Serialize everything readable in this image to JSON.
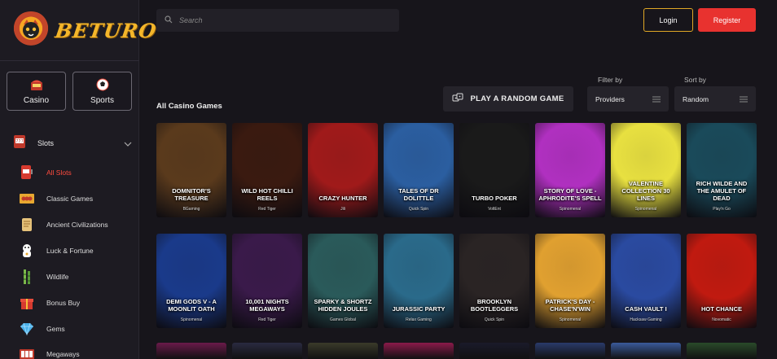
{
  "brand": {
    "name": "BETURO"
  },
  "sidebar": {
    "categories": [
      {
        "label": "Casino",
        "icon": "casino-icon"
      },
      {
        "label": "Sports",
        "icon": "soccer-ball-icon"
      }
    ],
    "section": {
      "label": "Slots",
      "icon": "slot-machine-icon",
      "expanded": true
    },
    "items": [
      {
        "label": "All Slots",
        "icon": "slot-machine-icon",
        "active": true
      },
      {
        "label": "Classic Games",
        "icon": "cherries-icon",
        "active": false
      },
      {
        "label": "Ancient Civilizations",
        "icon": "scroll-icon",
        "active": false
      },
      {
        "label": "Luck & Fortune",
        "icon": "lucky-cat-icon",
        "active": false
      },
      {
        "label": "Wildlife",
        "icon": "bamboo-icon",
        "active": false
      },
      {
        "label": "Bonus Buy",
        "icon": "gift-icon",
        "active": false
      },
      {
        "label": "Gems",
        "icon": "gem-icon",
        "active": false
      },
      {
        "label": "Megaways",
        "icon": "reels-icon",
        "active": false
      }
    ]
  },
  "header": {
    "search": {
      "placeholder": "Search",
      "value": ""
    },
    "login_label": "Login",
    "register_label": "Register"
  },
  "main": {
    "section_title": "All Casino Games",
    "random_label": "PLAY A RANDOM GAME",
    "filter": {
      "label": "Filter by",
      "value": "Providers"
    },
    "sort": {
      "label": "Sort by",
      "value": "Random"
    },
    "games_row1": [
      {
        "name": "DOMNITOR'S TREASURE",
        "provider": "BGaming"
      },
      {
        "name": "WILD HOT CHILLI REELS",
        "provider": "Red Tiger"
      },
      {
        "name": "CRAZY HUNTER",
        "provider": "Jili"
      },
      {
        "name": "TALES OF DR DOLITTLE",
        "provider": "Quick Spin"
      },
      {
        "name": "TURBO POKER",
        "provider": "VoltEnt"
      },
      {
        "name": "STORY OF LOVE - APHRODITE'S SPELL",
        "provider": "Spinomenal"
      },
      {
        "name": "VALENTINE COLLECTION 30 LINES",
        "provider": "Spinomenal"
      },
      {
        "name": "RICH WILDE AND THE AMULET OF DEAD",
        "provider": "Play'n Go"
      }
    ],
    "games_row2": [
      {
        "name": "DEMI GODS V - A MOONLIT OATH",
        "provider": "Spinomenal"
      },
      {
        "name": "10,001 NIGHTS MEGAWAYS",
        "provider": "Red Tiger"
      },
      {
        "name": "SPARKY & SHORTZ HIDDEN JOULES",
        "provider": "Games Global"
      },
      {
        "name": "JURASSIC PARTY",
        "provider": "Relax Gaming"
      },
      {
        "name": "BROOKLYN BOOTLEGGERS",
        "provider": "Quick Spin"
      },
      {
        "name": "PATRICK'S DAY - CHASE'N'WIN",
        "provider": "Spinomenal"
      },
      {
        "name": "CASH VAULT I",
        "provider": "Hacksaw Gaming"
      },
      {
        "name": "HOT CHANCE",
        "provider": "Novomatic"
      }
    ],
    "tile_art": {
      "row1": [
        "#5a3a1c",
        "#3a1a10",
        "#a01a1a",
        "#2b5ea0",
        "#1a1a1a",
        "#b030c0",
        "#e8e040",
        "#1a4a5a"
      ],
      "row2": [
        "#1a3a8a",
        "#3a1a4a",
        "#2a5a5a",
        "#2a6a8a",
        "#2a2424",
        "#e0a030",
        "#2a4aa0",
        "#c01a10"
      ],
      "row3": [
        "#6a1a4a",
        "#2a2a40",
        "#3a3a2a",
        "#8a1a4a",
        "#1a1a2a",
        "#2a3a6a",
        "#3a5a9a",
        "#2a4a2a"
      ]
    },
    "colors": {
      "accent": "#e8322f",
      "gold": "#e0a826",
      "active_nav": "#ff4b3e"
    }
  }
}
